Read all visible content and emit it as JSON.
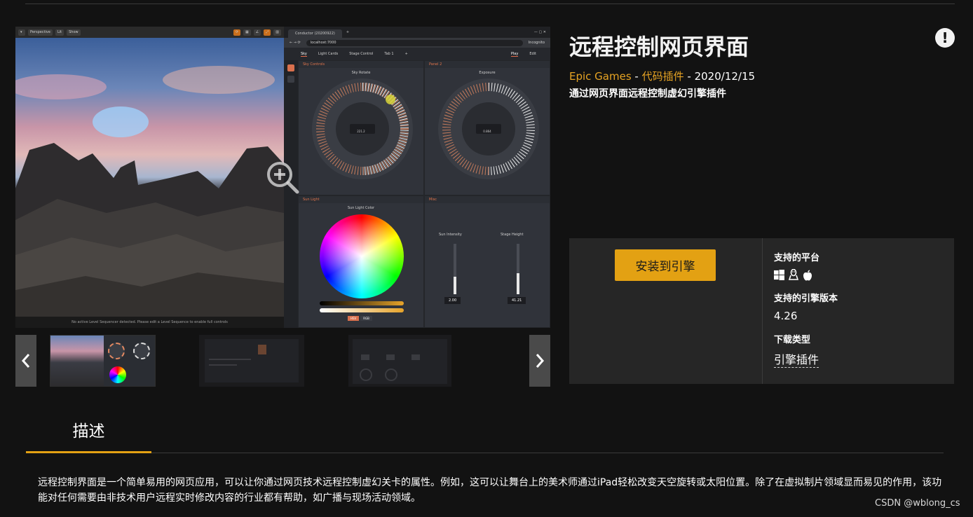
{
  "product": {
    "title": "远程控制网页界面",
    "publisher": "Epic Games",
    "separator1": " - ",
    "category": "代码插件",
    "separator2": " - ",
    "date": "2020/12/15",
    "tagline": "通过网页界面远程控制虚幻引擎插件"
  },
  "hero_screenshot": {
    "viewport_toolbar": [
      "Perspective",
      "Lit",
      "Show"
    ],
    "viewport_status": "No active Level Sequencer detected. Please edit a Level Sequence to enable full controls",
    "browser_tab": "Conductor (20200922)",
    "browser_url": "localhost:7000",
    "browser_profile": "Incognito",
    "app_tabs": [
      "Sky",
      "Light Cards",
      "Stage Control",
      "Tab 1"
    ],
    "app_modes": [
      "Play",
      "Edit"
    ],
    "panels": {
      "sky_controls": {
        "header": "Sky Controls",
        "label": "Sky Rotate",
        "value": "221.2"
      },
      "panel2": {
        "header": "Panel 2",
        "label": "Exposure",
        "value": "0.864"
      },
      "sun_light": {
        "header": "Sun Light",
        "label": "Sun Light Color",
        "mode_a": "HSV",
        "mode_b": "RGB"
      },
      "misc": {
        "header": "Misc",
        "slider_a_label": "Sun Intensity",
        "slider_a_value": "2.00",
        "slider_a_level": 0.35,
        "slider_b_label": "Stage Height",
        "slider_b_value": "41.21",
        "slider_b_level": 0.42
      }
    }
  },
  "gallery": {
    "prev_icon": "chevron-left-icon",
    "next_icon": "chevron-right-icon",
    "zoom_icon": "zoom-in-icon"
  },
  "alert_icon_glyph": "!",
  "purchase": {
    "install_label": "安装到引擎",
    "platforms_heading": "支持的平台",
    "platform_icons": [
      "windows-icon",
      "linux-icon",
      "apple-icon"
    ],
    "engine_heading": "支持的引擎版本",
    "engine_version": "4.26",
    "download_heading": "下载类型",
    "download_type": "引擎插件"
  },
  "description": {
    "tab_label": "描述",
    "text": "远程控制界面是一个简单易用的网页应用，可以让你通过网页技术远程控制虚幻关卡的属性。例如，这可以让舞台上的美术师通过iPad轻松改变天空旋转或太阳位置。除了在虚拟制片领域显而易见的作用，该功能对任何需要由非技术用户远程实时修改内容的行业都有帮助，如广播与现场活动领域。"
  },
  "watermark": "CSDN @wblong_cs",
  "colors": {
    "accent": "#e3a113",
    "link": "#e6a323",
    "background": "#121212",
    "panel": "#262626"
  }
}
